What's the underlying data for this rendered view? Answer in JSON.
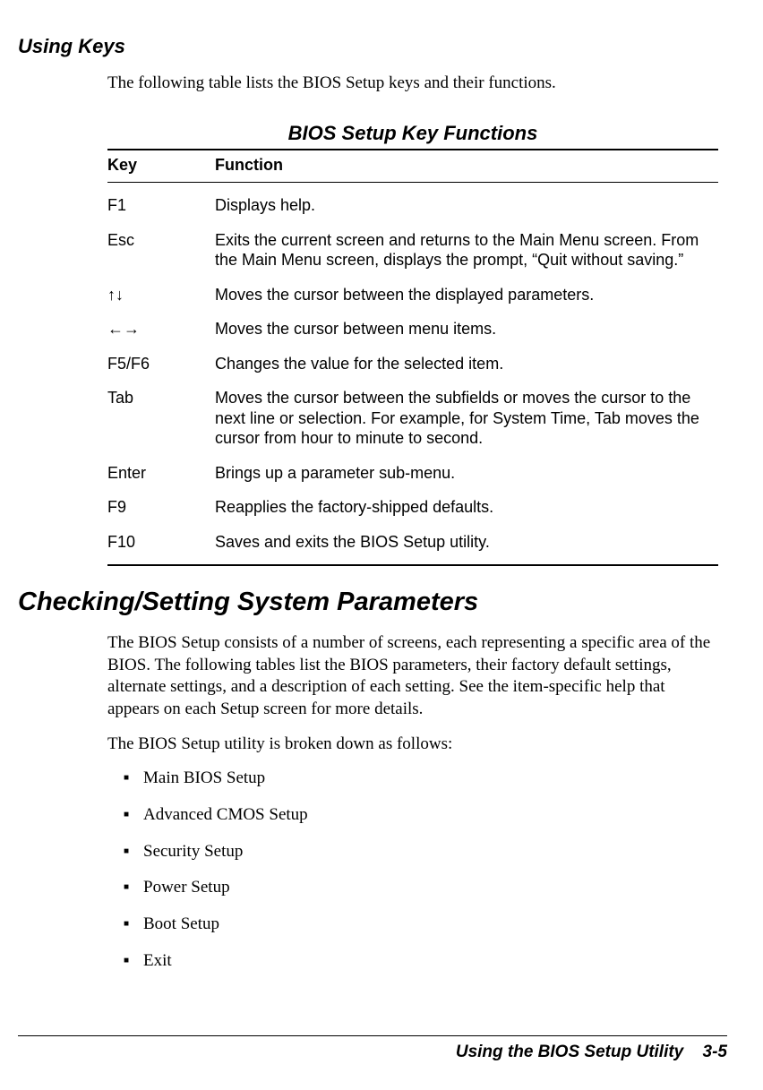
{
  "section1": {
    "heading": "Using Keys",
    "intro": "The following table lists the BIOS Setup keys and their functions."
  },
  "table": {
    "title": "BIOS Setup Key Functions",
    "headers": {
      "key": "Key",
      "function": "Function"
    },
    "rows": [
      {
        "key": "F1",
        "function": "Displays help."
      },
      {
        "key": "Esc",
        "function": "Exits the current screen and returns to the Main Menu screen. From the Main Menu screen, displays the prompt, “Quit without saving.”"
      },
      {
        "key": "↑↓",
        "function": "Moves the cursor between the displayed parameters."
      },
      {
        "key": "←→",
        "function": "Moves the cursor between menu items."
      },
      {
        "key": "F5/F6",
        "function": "Changes the value for the selected item."
      },
      {
        "key": "Tab",
        "function": "Moves the cursor between the subfields or moves the cursor to the next line or selection. For example, for System Time, Tab moves the cursor from hour to minute to second."
      },
      {
        "key": "Enter",
        "function": "Brings up a parameter sub-menu."
      },
      {
        "key": "F9",
        "function": "Reapplies the factory-shipped defaults."
      },
      {
        "key": "F10",
        "function": "Saves and exits the BIOS Setup utility."
      }
    ]
  },
  "section2": {
    "heading": "Checking/Setting System Parameters",
    "para1": "The BIOS Setup consists of a number of screens, each representing a specific area of the BIOS. The following tables list the BIOS parameters, their factory default settings, alternate settings, and a description of each setting. See the item-specific help that appears on each Setup screen for more details.",
    "para2": "The BIOS Setup utility is broken down as follows:",
    "list": [
      "Main BIOS Setup",
      "Advanced CMOS Setup",
      "Security Setup",
      "Power Setup",
      "Boot Setup",
      "Exit"
    ]
  },
  "footer": {
    "title": "Using the BIOS Setup Utility",
    "page": "3-5"
  }
}
